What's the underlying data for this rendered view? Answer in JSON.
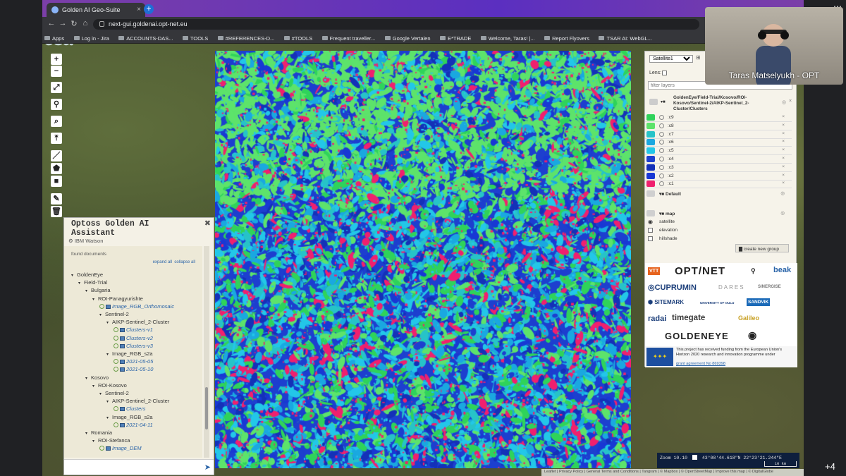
{
  "browser": {
    "tab_title": "Golden AI Geo-Suite",
    "url": "next-gui.goldenai.opt-net.eu",
    "bookmarks": [
      "Apps",
      "Log in - Jira",
      "ACCOUNTS-DAS...",
      "TOOLS",
      "#REFERENCES-D...",
      "#TOOLS",
      "Frequent traveller...",
      "Google Vertalen",
      "E*TRADE",
      "Welcome, Taras! |...",
      "Report Flyovers",
      "TSAR AI: WebGL..."
    ]
  },
  "map": {
    "esa_logo": "esa",
    "controls": [
      "+",
      "−",
      "⤢",
      "⚲",
      "⌕",
      "⤒",
      "／",
      "⬟",
      "■",
      "✎",
      "🗑"
    ]
  },
  "assistant": {
    "title": "Optoss Golden AI Assistant",
    "subtitle": "IBM Watson",
    "found_documents": "found documents",
    "expand_all": "expand all",
    "collapse_all": "collapse all",
    "tree": [
      {
        "label": "GoldenEye",
        "level": 0,
        "type": "folder"
      },
      {
        "label": "Field-Trial",
        "level": 1,
        "type": "folder"
      },
      {
        "label": "Bulgaria",
        "level": 2,
        "type": "folder"
      },
      {
        "label": "ROI-Panagyurishte",
        "level": 3,
        "type": "folder"
      },
      {
        "label": "Image_RGB_Orthomosaic",
        "level": 4,
        "type": "image"
      },
      {
        "label": "Sentinel-2",
        "level": 4,
        "type": "folder"
      },
      {
        "label": "AIKP-Sentinel_2-Cluster",
        "level": 5,
        "type": "folder"
      },
      {
        "label": "Clusters-v1",
        "level": 6,
        "type": "layer"
      },
      {
        "label": "Clusters-v2",
        "level": 6,
        "type": "layer"
      },
      {
        "label": "Clusters-v3",
        "level": 6,
        "type": "layer"
      },
      {
        "label": "Image_RGB_s2a",
        "level": 5,
        "type": "folder"
      },
      {
        "label": "2021-05-05",
        "level": 6,
        "type": "image"
      },
      {
        "label": "2021-05-10",
        "level": 6,
        "type": "image"
      },
      {
        "label": "Kosovo",
        "level": 2,
        "type": "folder"
      },
      {
        "label": "ROI-Kosovo",
        "level": 3,
        "type": "folder"
      },
      {
        "label": "Sentinel-2",
        "level": 4,
        "type": "folder"
      },
      {
        "label": "AIKP-Sentinel_2-Cluster",
        "level": 5,
        "type": "folder"
      },
      {
        "label": "Clusters",
        "level": 6,
        "type": "layer"
      },
      {
        "label": "Image_RGB_s2a",
        "level": 5,
        "type": "folder"
      },
      {
        "label": "2021-04-11",
        "level": 6,
        "type": "image"
      },
      {
        "label": "Romania",
        "level": 2,
        "type": "folder"
      },
      {
        "label": "ROI-Stefanca",
        "level": 3,
        "type": "folder"
      },
      {
        "label": "Image_DEM",
        "level": 4,
        "type": "image"
      }
    ]
  },
  "layers": {
    "basemap_select": "Satellite1",
    "lens_label": "Lens:",
    "filter_placeholder": "filter layers",
    "group_path": "GoldenEye/Field-Trial/Kosovo/ROI-Kosovo/Sentinel-2/AIKP-Sentinel_2-Cluster/Clusters",
    "clusters": [
      {
        "name": ":c9",
        "color": "#2fd35a"
      },
      {
        "name": ":c8",
        "color": "#5de36b"
      },
      {
        "name": ":c7",
        "color": "#27c3c8"
      },
      {
        "name": ":c6",
        "color": "#1aa8e0"
      },
      {
        "name": ":c5",
        "color": "#23c7e8"
      },
      {
        "name": ":c4",
        "color": "#1d3fcf"
      },
      {
        "name": ":c3",
        "color": "#1431b8"
      },
      {
        "name": ":c2",
        "color": "#1838d4"
      },
      {
        "name": ":c1",
        "color": "#f0206e"
      }
    ],
    "default_group": "Default",
    "map_group": "map",
    "base_layers": [
      "satellite",
      "elevation",
      "hillshade"
    ],
    "create_group": "create new group"
  },
  "logos": {
    "vtt": "VTT",
    "optnet": "OPT/NET",
    "beak": "beak",
    "cuprumin": "CUPRUMIN",
    "dares": "DARES",
    "sinergise": "SINERGISE",
    "sitemark": "SITEMARK",
    "oulu": "UNIVERSITY OF OULU",
    "sandvik": "SANDVIK",
    "radai": "radai",
    "timegate": "timegate",
    "galileo": "Galileo",
    "goldeneye": "GOLDENEYE",
    "funding": "This project has received funding from the European Union's Horizon 2020 research and innovation programme under",
    "grant": "grant agreement No 869398"
  },
  "status": {
    "zoom": "Zoom 10.10",
    "coords": "43°08'44.618\"N    22°23'21.244\"E",
    "scale": "10 km",
    "attribution": "Leaflet | Privacy Policy | General Terms and Conditions | Tangram | © Mapbox | © OpenStreetMap | Improve this map | © DigitalGlobe"
  },
  "meeting": {
    "participant": "Taras Matselyukh - OPT",
    "others": "+4",
    "more": "⋯"
  }
}
